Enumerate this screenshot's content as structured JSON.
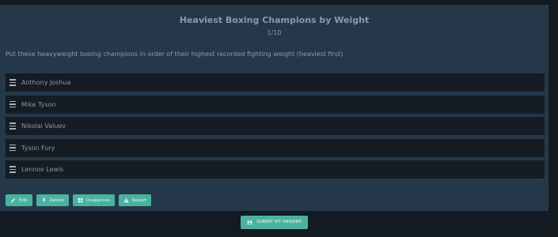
{
  "quiz": {
    "title": "Heaviest Boxing Champions by Weight",
    "counter": "1/10",
    "question": "Put these heavyweight boxing champions in order of their highest recorded fighting weight (heaviest first)",
    "items": [
      {
        "label": "Anthony Joshua"
      },
      {
        "label": "Mike Tyson"
      },
      {
        "label": "Nikolai Valuev"
      },
      {
        "label": "Tyson Fury"
      },
      {
        "label": "Lennox Lewis"
      }
    ]
  },
  "actions": {
    "edit_label": "Edit",
    "delete_label": "Delete",
    "unapprove_label": "Unapprove",
    "report_label": "Report"
  },
  "footer": {
    "submit_label": "SUBMIT MY ANSWER"
  },
  "colors": {
    "accent": "#4ab39f",
    "card_bg": "#24384a",
    "item_bg": "#151c23",
    "page_bg": "#151a1f"
  },
  "icons": {
    "edit": "pencil-icon",
    "delete": "thumbtack-icon",
    "unapprove": "grid-icon",
    "report": "warning-icon",
    "submit": "floppy-disk-icon",
    "drag": "drag-handle-icon"
  }
}
